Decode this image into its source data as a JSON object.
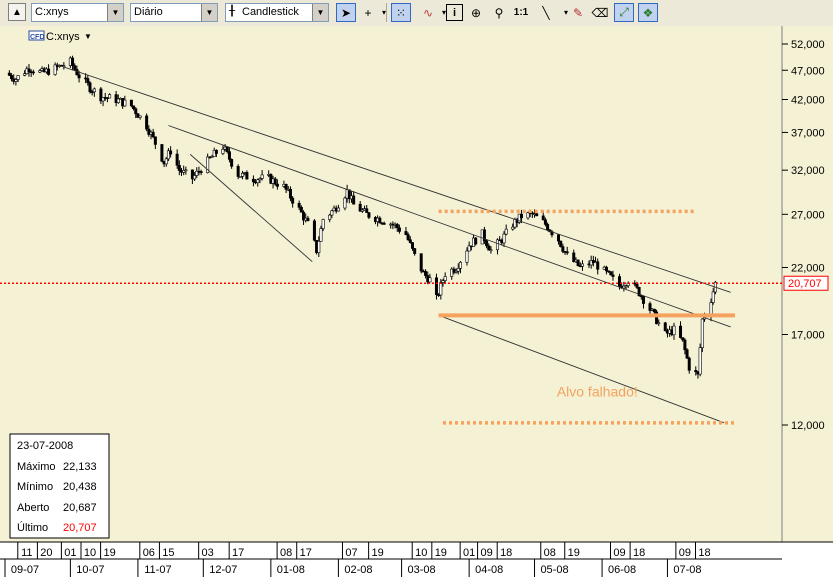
{
  "toolbar": {
    "symbol_value": "C:xnys",
    "period_value": "Diário",
    "chart_type_value": "Candlestick",
    "zoom_label": "1:1",
    "icons": [
      "scroll-up-icon",
      "cursor-arrow-icon",
      "crosshair-icon",
      "grid-icon",
      "indicator-icon",
      "info-icon",
      "zoom-in-icon",
      "search-icon",
      "zoom-1-1-icon",
      "trendline-icon",
      "eraser-icon",
      "auto-trend-icon",
      "scanner-icon"
    ]
  },
  "chart_header": {
    "symbol_badge": "CFD",
    "symbol_label": "C:xnys"
  },
  "info_box": {
    "date": "23-07-2008",
    "rows": [
      {
        "label": "Máximo",
        "value": "22,133"
      },
      {
        "label": "Mínimo",
        "value": "20,438"
      },
      {
        "label": "Aberto",
        "value": "20,687"
      },
      {
        "label": "Último",
        "value": "20,707"
      }
    ]
  },
  "colors": {
    "plot_bg": "#f4f1d4",
    "last_price_line": "#ff0000",
    "support_line": "#f5a25e",
    "annotation": "#f5a25e"
  },
  "chart_data": {
    "type": "candlestick",
    "scale": "log",
    "ylim": [
      9,
      55
    ],
    "y_ticks": [
      "12,000",
      "17,000",
      "22,000",
      "27,000",
      "32,000",
      "37,000",
      "42,000",
      "47,000",
      "52,000"
    ],
    "y_tick_values": [
      12,
      17,
      22,
      27,
      32,
      37,
      42,
      47,
      52
    ],
    "last_price": {
      "value": 20.707,
      "label": "20,707"
    },
    "x_range": [
      "2007-09-01",
      "2008-08-01"
    ],
    "x_day_ticks": [
      {
        "label": "11",
        "date": "2007-09-11"
      },
      {
        "label": "20",
        "date": "2007-09-20"
      },
      {
        "label": "01",
        "date": "2007-10-01"
      },
      {
        "label": "10",
        "date": "2007-10-10"
      },
      {
        "label": "19",
        "date": "2007-10-19"
      },
      {
        "label": "06",
        "date": "2007-11-06"
      },
      {
        "label": "15",
        "date": "2007-11-15"
      },
      {
        "label": "03",
        "date": "2007-12-03"
      },
      {
        "label": "17",
        "date": "2007-12-17"
      },
      {
        "label": "08",
        "date": "2008-01-08"
      },
      {
        "label": "17",
        "date": "2008-01-17"
      },
      {
        "label": "07",
        "date": "2008-02-07"
      },
      {
        "label": "19",
        "date": "2008-02-19"
      },
      {
        "label": "10",
        "date": "2008-03-10"
      },
      {
        "label": "19",
        "date": "2008-03-19"
      },
      {
        "label": "01",
        "date": "2008-04-01"
      },
      {
        "label": "09",
        "date": "2008-04-09"
      },
      {
        "label": "18",
        "date": "2008-04-18"
      },
      {
        "label": "08",
        "date": "2008-05-08"
      },
      {
        "label": "19",
        "date": "2008-05-19"
      },
      {
        "label": "09",
        "date": "2008-06-09"
      },
      {
        "label": "18",
        "date": "2008-06-18"
      },
      {
        "label": "09",
        "date": "2008-07-09"
      },
      {
        "label": "18",
        "date": "2008-07-18"
      }
    ],
    "x_month_ticks": [
      {
        "label": "09-07",
        "date": "2007-09-01"
      },
      {
        "label": "10-07",
        "date": "2007-10-01"
      },
      {
        "label": "11-07",
        "date": "2007-11-01"
      },
      {
        "label": "12-07",
        "date": "2007-12-01"
      },
      {
        "label": "01-08",
        "date": "2008-01-01"
      },
      {
        "label": "02-08",
        "date": "2008-02-01"
      },
      {
        "label": "03-08",
        "date": "2008-03-01"
      },
      {
        "label": "04-08",
        "date": "2008-04-01"
      },
      {
        "label": "05-08",
        "date": "2008-05-01"
      },
      {
        "label": "06-08",
        "date": "2008-06-01"
      },
      {
        "label": "07-08",
        "date": "2008-07-01"
      }
    ],
    "price_path": [
      [
        "2007-09-01",
        46.5
      ],
      [
        "2007-09-06",
        45.5
      ],
      [
        "2007-09-12",
        47.5
      ],
      [
        "2007-09-18",
        46.5
      ],
      [
        "2007-09-25",
        47.5
      ],
      [
        "2007-10-01",
        48.5
      ],
      [
        "2007-10-05",
        46.0
      ],
      [
        "2007-10-10",
        44.0
      ],
      [
        "2007-10-15",
        42.5
      ],
      [
        "2007-10-22",
        42.0
      ],
      [
        "2007-10-29",
        41.0
      ],
      [
        "2007-11-05",
        38.0
      ],
      [
        "2007-11-09",
        35.5
      ],
      [
        "2007-11-13",
        33.0
      ],
      [
        "2007-11-16",
        34.5
      ],
      [
        "2007-11-20",
        32.0
      ],
      [
        "2007-11-26",
        31.0
      ],
      [
        "2007-12-01",
        32.5
      ],
      [
        "2007-12-06",
        34.0
      ],
      [
        "2007-12-10",
        35.0
      ],
      [
        "2007-12-17",
        31.5
      ],
      [
        "2007-12-24",
        31.0
      ],
      [
        "2007-12-31",
        31.0
      ],
      [
        "2008-01-07",
        30.0
      ],
      [
        "2008-01-14",
        27.5
      ],
      [
        "2008-01-18",
        26.0
      ],
      [
        "2008-01-22",
        23.5
      ],
      [
        "2008-01-25",
        26.5
      ],
      [
        "2008-01-30",
        27.5
      ],
      [
        "2008-02-05",
        29.5
      ],
      [
        "2008-02-08",
        28.0
      ],
      [
        "2008-02-14",
        27.0
      ],
      [
        "2008-02-20",
        26.5
      ],
      [
        "2008-02-26",
        26.0
      ],
      [
        "2008-03-03",
        25.0
      ],
      [
        "2008-03-07",
        23.0
      ],
      [
        "2008-03-11",
        21.5
      ],
      [
        "2008-03-14",
        21.0
      ],
      [
        "2008-03-17",
        19.5
      ],
      [
        "2008-03-21",
        21.5
      ],
      [
        "2008-03-26",
        22.0
      ],
      [
        "2008-04-01",
        24.0
      ],
      [
        "2008-04-07",
        25.0
      ],
      [
        "2008-04-11",
        23.5
      ],
      [
        "2008-04-16",
        24.5
      ],
      [
        "2008-04-21",
        26.0
      ],
      [
        "2008-04-25",
        26.8
      ],
      [
        "2008-04-30",
        27.0
      ],
      [
        "2008-05-06",
        26.0
      ],
      [
        "2008-05-12",
        24.5
      ],
      [
        "2008-05-16",
        23.0
      ],
      [
        "2008-05-22",
        22.0
      ],
      [
        "2008-05-28",
        22.5
      ],
      [
        "2008-06-03",
        21.5
      ],
      [
        "2008-06-09",
        20.5
      ],
      [
        "2008-06-13",
        21.0
      ],
      [
        "2008-06-18",
        20.0
      ],
      [
        "2008-06-24",
        18.5
      ],
      [
        "2008-06-30",
        17.0
      ],
      [
        "2008-07-04",
        17.3
      ],
      [
        "2008-07-08",
        16.5
      ],
      [
        "2008-07-11",
        15.0
      ],
      [
        "2008-07-15",
        14.5
      ],
      [
        "2008-07-17",
        18.0
      ],
      [
        "2008-07-21",
        19.5
      ],
      [
        "2008-07-23",
        20.7
      ]
    ],
    "annotations": [
      {
        "kind": "trendline",
        "from": [
          "2007-09-25",
          48.0
        ],
        "to": [
          "2008-07-30",
          20.0
        ]
      },
      {
        "kind": "trendline",
        "from": [
          "2007-11-15",
          38.0
        ],
        "to": [
          "2008-07-30",
          17.5
        ]
      },
      {
        "kind": "trendline",
        "from": [
          "2007-11-25",
          34.0
        ],
        "to": [
          "2008-01-20",
          22.5
        ]
      },
      {
        "kind": "trendline",
        "from": [
          "2008-03-18",
          18.3
        ],
        "to": [
          "2008-07-27",
          12.1
        ]
      },
      {
        "kind": "dotted-level",
        "value": 27.3,
        "from": "2008-03-18",
        "to": "2008-07-13"
      },
      {
        "kind": "dotted-level",
        "value": 12.1,
        "from": "2008-03-20",
        "to": "2008-08-01"
      },
      {
        "kind": "solid-level",
        "value": 18.3,
        "from": "2008-03-18",
        "to": "2008-08-01"
      },
      {
        "kind": "text",
        "text": "Alvo falhado!",
        "at": [
          "2008-05-25",
          13.4
        ]
      }
    ]
  }
}
